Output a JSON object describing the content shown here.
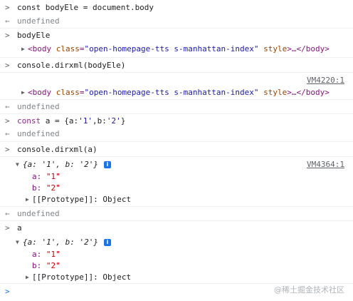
{
  "console": {
    "entries": {
      "e1": {
        "code": "const bodyEle = document.body"
      },
      "e2": {
        "result": "undefined"
      },
      "e3": {
        "code": "bodyEle"
      },
      "e4": {
        "tag_open": "<body ",
        "attr_name": "class",
        "attr_eq": "=",
        "attr_value": "\"open-homepage-tts s-manhattan-index\"",
        "attr2": " style",
        "rest": ">…</body>"
      },
      "e5": {
        "code": "console.dirxml(bodyEle)"
      },
      "e6": {
        "source": "VM4220:1",
        "tag_open": "<body ",
        "attr_name": "class",
        "attr_eq": "=",
        "attr_value": "\"open-homepage-tts s-manhattan-index\"",
        "attr2": " style",
        "rest": ">…</body>"
      },
      "e7": {
        "result": "undefined"
      },
      "e8": {
        "code_kw": "const",
        "code_rest": " a = {a:",
        "code_s1": "'1'",
        "code_mid": ",b:",
        "code_s2": "'2'",
        "code_end": "}"
      },
      "e9": {
        "result": "undefined"
      },
      "e10": {
        "code": "console.dirxml(a)"
      },
      "e11": {
        "source": "VM4364:1",
        "summary_open": "{a: ",
        "summary_v1": "'1'",
        "summary_mid": ", b: ",
        "summary_v2": "'2'",
        "summary_close": "}",
        "prop_a_key": "a:",
        "prop_a_val": "\"1\"",
        "prop_b_key": "b:",
        "prop_b_val": "\"2\"",
        "proto": "[[Prototype]]: Object"
      },
      "e12": {
        "result": "undefined"
      },
      "e13": {
        "code": "a"
      },
      "e14": {
        "summary_open": "{a: ",
        "summary_v1": "'1'",
        "summary_mid": ", b: ",
        "summary_v2": "'2'",
        "summary_close": "}",
        "prop_a_key": "a:",
        "prop_a_val": "\"1\"",
        "prop_b_key": "b:",
        "prop_b_val": "\"2\"",
        "proto": "[[Prototype]]: Object"
      }
    },
    "prompt_symbol": ">",
    "result_symbol": "←",
    "info_badge": "i",
    "watermark": "@稀土掘金技术社区"
  },
  "colors": {
    "keyword": "#9b2393",
    "string": "#1a1aa6",
    "tag": "#881280",
    "attr": "#994500",
    "link": "#5f6368",
    "accent": "#1a73e8"
  }
}
